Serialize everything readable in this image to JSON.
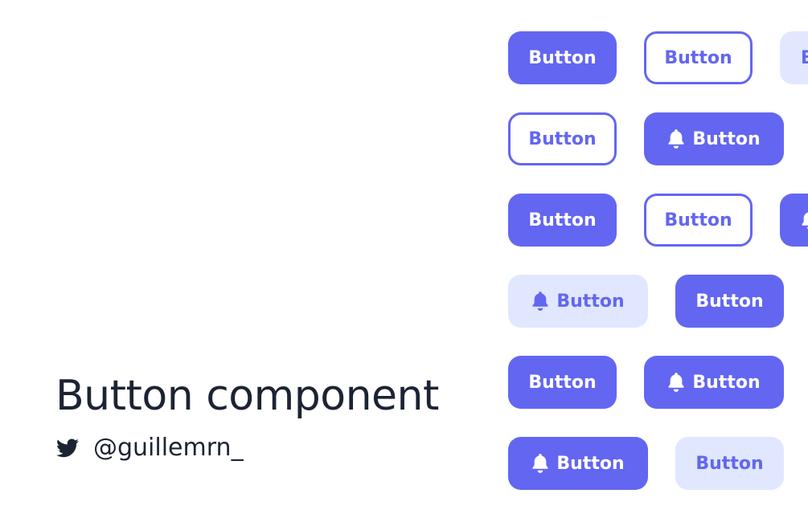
{
  "heading": {
    "title": "Button component",
    "handle": "@guillemrn_",
    "icon": "twitter-icon"
  },
  "colors": {
    "primary": "#6366f1",
    "soft": "#e0e7ff",
    "text": "#1c2333"
  },
  "buttons": [
    {
      "label": "Button",
      "style": "solid",
      "icon": null
    },
    {
      "label": "Button",
      "style": "outline",
      "icon": null
    },
    {
      "label": "B",
      "style": "soft",
      "icon": null
    },
    {
      "label": "Button",
      "style": "outline",
      "icon": null
    },
    {
      "label": "Button",
      "style": "solid",
      "icon": "bell-icon"
    },
    {
      "label": "Button",
      "style": "solid",
      "icon": null
    },
    {
      "label": "Button",
      "style": "outline",
      "icon": null
    },
    {
      "label": "",
      "style": "solid",
      "icon": "bell-icon"
    },
    {
      "label": "Button",
      "style": "soft",
      "icon": "bell-icon"
    },
    {
      "label": "Button",
      "style": "solid",
      "icon": null
    },
    {
      "label": "Button",
      "style": "solid",
      "icon": null
    },
    {
      "label": "Button",
      "style": "solid",
      "icon": "bell-icon"
    },
    {
      "label": "Button",
      "style": "solid",
      "icon": "bell-icon"
    },
    {
      "label": "Button",
      "style": "soft",
      "icon": null
    }
  ]
}
